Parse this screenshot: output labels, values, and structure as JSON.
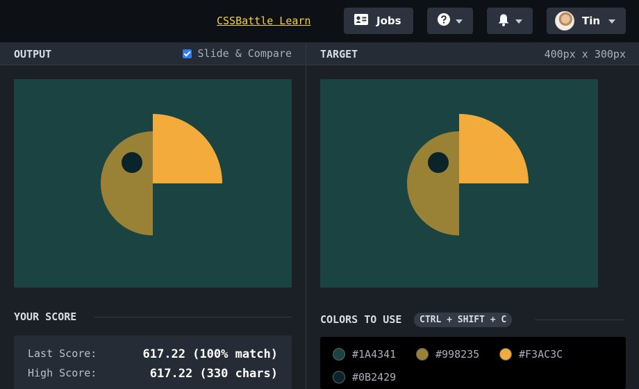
{
  "nav": {
    "learn_link": "CSSBattle Learn",
    "jobs_label": "Jobs",
    "user_name": "Tin",
    "icons": {
      "jobs": "id-card-icon",
      "help": "question-circle-icon",
      "bell": "bell-icon"
    }
  },
  "output": {
    "title": "OUTPUT",
    "slide_compare_label": "Slide & Compare",
    "slide_compare_checked": true
  },
  "target": {
    "title": "TARGET",
    "dimensions": "400px x 300px"
  },
  "canvas": {
    "background": "#1A4341",
    "shapes": [
      {
        "name": "olive-half-circle",
        "color": "#998235"
      },
      {
        "name": "orange-quarter-circle",
        "color": "#F3AC3C"
      },
      {
        "name": "eye-dot",
        "color": "#0B2429"
      }
    ]
  },
  "score": {
    "title": "YOUR SCORE",
    "last_label": "Last Score:",
    "last_value": "617.22 (100% match)",
    "high_label": "High Score:",
    "high_value": "617.22 (330 chars)"
  },
  "colors": {
    "title": "COLORS TO USE",
    "shortcut": "CTRL + SHIFT + C",
    "items": [
      {
        "label": "#1A4341",
        "hex": "#1A4341"
      },
      {
        "label": "#998235",
        "hex": "#998235"
      },
      {
        "label": "#F3AC3C",
        "hex": "#F3AC3C"
      },
      {
        "label": "#0B2429",
        "hex": "#0B2429"
      }
    ]
  }
}
